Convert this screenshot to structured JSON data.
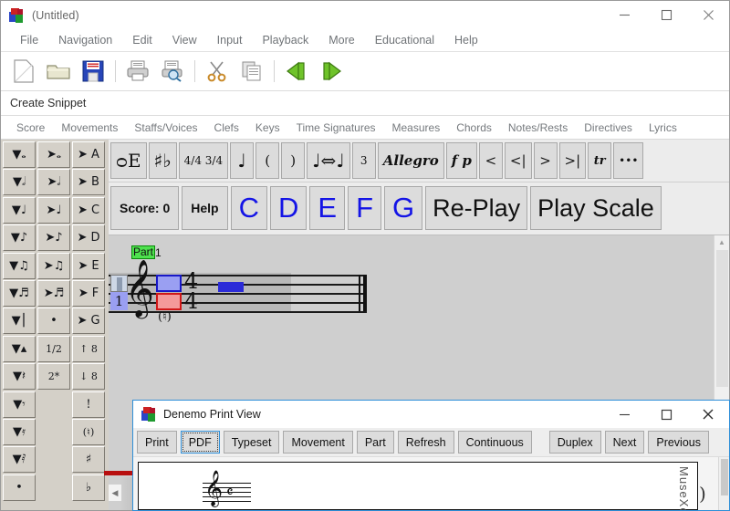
{
  "window": {
    "title": "(Untitled)",
    "icon": "denemo-cube-icon",
    "controls": {
      "minimize": "minimize-icon",
      "maximize": "maximize-icon",
      "close": "close-icon"
    }
  },
  "menubar": {
    "items": [
      "File",
      "Navigation",
      "Edit",
      "View",
      "Input",
      "Playback",
      "More",
      "Educational",
      "Help"
    ]
  },
  "toolbar": {
    "buttons": [
      {
        "name": "new-document-icon",
        "glyph": "page"
      },
      {
        "name": "open-folder-icon",
        "glyph": "folder"
      },
      {
        "name": "save-icon",
        "glyph": "floppy"
      },
      {
        "name": "print-icon",
        "glyph": "printer"
      },
      {
        "name": "print-preview-icon",
        "glyph": "preview"
      },
      {
        "name": "cut-icon",
        "glyph": "scissors"
      },
      {
        "name": "copy-icon",
        "glyph": "copy"
      },
      {
        "name": "go-start-icon",
        "glyph": "arrow-left-bar"
      },
      {
        "name": "go-end-icon",
        "glyph": "arrow-right-bar"
      }
    ]
  },
  "snippet_bar": {
    "label": "Create Snippet"
  },
  "palette_tabs": {
    "items": [
      "Score",
      "Movements",
      "Staffs/Voices",
      "Clefs",
      "Keys",
      "Time Signatures",
      "Measures",
      "Chords",
      "Notes/Rests",
      "Directives",
      "Lyrics"
    ]
  },
  "object_palette": {
    "buttons": [
      {
        "name": "clef-button",
        "label": "ᴑE"
      },
      {
        "name": "key-signature-button",
        "label": "♯♭"
      },
      {
        "name": "time-signature-button",
        "label": "4/4 3/4"
      },
      {
        "name": "note-duration-button",
        "label": "♩"
      },
      {
        "name": "slur-open-button",
        "label": "("
      },
      {
        "name": "slur-close-button",
        "label": ")"
      },
      {
        "name": "tie-button",
        "label": "♩⇔♩"
      },
      {
        "name": "tuplet-button",
        "label": "3"
      },
      {
        "name": "tempo-allegro-button",
        "label": "Allegro"
      },
      {
        "name": "dynamic-fp-button",
        "label": "f p"
      },
      {
        "name": "crescendo-button",
        "label": "<"
      },
      {
        "name": "crescendo-end-button",
        "label": "<|"
      },
      {
        "name": "diminuendo-button",
        "label": ">"
      },
      {
        "name": "diminuendo-end-button",
        "label": ">|"
      },
      {
        "name": "trill-button",
        "label": "tr"
      },
      {
        "name": "more-button",
        "label": "•••"
      }
    ]
  },
  "educational_palette": {
    "buttons": [
      {
        "name": "score-display",
        "label": "Score: 0"
      },
      {
        "name": "help-button",
        "label": "Help"
      },
      {
        "name": "note-c-button",
        "label": "C"
      },
      {
        "name": "note-d-button",
        "label": "D"
      },
      {
        "name": "note-e-button",
        "label": "E"
      },
      {
        "name": "note-f-button",
        "label": "F"
      },
      {
        "name": "note-g-button",
        "label": "G"
      },
      {
        "name": "replay-button",
        "label": "Re-Play"
      },
      {
        "name": "play-scale-button",
        "label": "Play Scale"
      }
    ]
  },
  "note_palette": {
    "rows": [
      [
        {
          "name": "insert-whole-note",
          "label": "▼𝅝"
        },
        {
          "name": "change-whole-note",
          "label": "➤𝅝"
        },
        {
          "name": "append-note-a",
          "label": "➤ A"
        }
      ],
      [
        {
          "name": "insert-half-note",
          "label": "▼𝅗𝅥"
        },
        {
          "name": "change-half-note",
          "label": "➤𝅗𝅥"
        },
        {
          "name": "append-note-b",
          "label": "➤ B"
        }
      ],
      [
        {
          "name": "insert-quarter-note",
          "label": "▼♩"
        },
        {
          "name": "change-quarter-note",
          "label": "➤♩"
        },
        {
          "name": "append-note-c",
          "label": "➤ C"
        }
      ],
      [
        {
          "name": "insert-eighth-note",
          "label": "▼♪"
        },
        {
          "name": "change-eighth-note",
          "label": "➤♪"
        },
        {
          "name": "append-note-d",
          "label": "➤ D"
        }
      ],
      [
        {
          "name": "insert-sixteenth-note",
          "label": "▼♫"
        },
        {
          "name": "change-sixteenth-note",
          "label": "➤♫"
        },
        {
          "name": "append-note-e",
          "label": "➤ E"
        }
      ],
      [
        {
          "name": "insert-thirtysecond-note",
          "label": "▼♬"
        },
        {
          "name": "change-thirtysecond-note",
          "label": "➤♬"
        },
        {
          "name": "append-note-f",
          "label": "➤ F"
        }
      ],
      [
        {
          "name": "insert-breve",
          "label": "▼⎮"
        },
        {
          "name": "dot-button",
          "label": "•"
        },
        {
          "name": "append-note-g",
          "label": "➤ G"
        }
      ],
      [
        {
          "name": "insert-longa",
          "label": "▼▴"
        },
        {
          "name": "half-tuplet-button",
          "label": "1/2"
        },
        {
          "name": "octave-up-button",
          "label": "↑ 8"
        }
      ],
      [
        {
          "name": "insert-rest-quarter",
          "label": "▼𝄽"
        },
        {
          "name": "double-tuplet-button",
          "label": "2*"
        },
        {
          "name": "octave-down-button",
          "label": "↓ 8"
        }
      ],
      [
        {
          "name": "insert-rest-eighth",
          "label": "▼𝄾"
        },
        {
          "name": "spacer-1",
          "label": ""
        },
        {
          "name": "staccato-button",
          "label": "!"
        }
      ],
      [
        {
          "name": "insert-rest-sixteenth",
          "label": "▼𝄿"
        },
        {
          "name": "spacer-2",
          "label": ""
        },
        {
          "name": "natural-cautionary-button",
          "label": "(♮)"
        }
      ],
      [
        {
          "name": "insert-rest-thirtysecond",
          "label": "▼𝅀"
        },
        {
          "name": "spacer-3",
          "label": ""
        },
        {
          "name": "sharp-button",
          "label": "♯"
        }
      ],
      [
        {
          "name": "insert-dot",
          "label": "•"
        },
        {
          "name": "spacer-4",
          "label": ""
        },
        {
          "name": "flat-button",
          "label": "♭"
        }
      ]
    ]
  },
  "score_canvas": {
    "part_label": "Part",
    "part_number": "1",
    "measure_number": "1",
    "time_signature_top": "4",
    "time_signature_bottom": "4",
    "cautionary_accidental": "(♮)",
    "clef": "treble-clef",
    "colors": {
      "selection_blue_fill": "#9a9ff2",
      "selection_blue_border": "#1818c8",
      "selection_red_fill": "#f49a9a",
      "selection_red_border": "#d01818",
      "playback_marker": "#2b2bd8",
      "part_label_bg": "#4ee14e"
    }
  },
  "print_view": {
    "title": "Denemo Print View",
    "icon": "denemo-cube-icon",
    "controls": {
      "minimize": "minimize-icon",
      "maximize": "maximize-icon",
      "close": "close-icon"
    },
    "toolbar_left": [
      "Print",
      "PDF",
      "Typeset",
      "Movement",
      "Part",
      "Refresh",
      "Continuous"
    ],
    "toolbar_right": [
      "Duplex",
      "Next",
      "Previous"
    ],
    "focused_button": "PDF",
    "page": {
      "clef": "treble-clef",
      "time_signature": "common-time"
    },
    "watermark": "MuseXe"
  }
}
